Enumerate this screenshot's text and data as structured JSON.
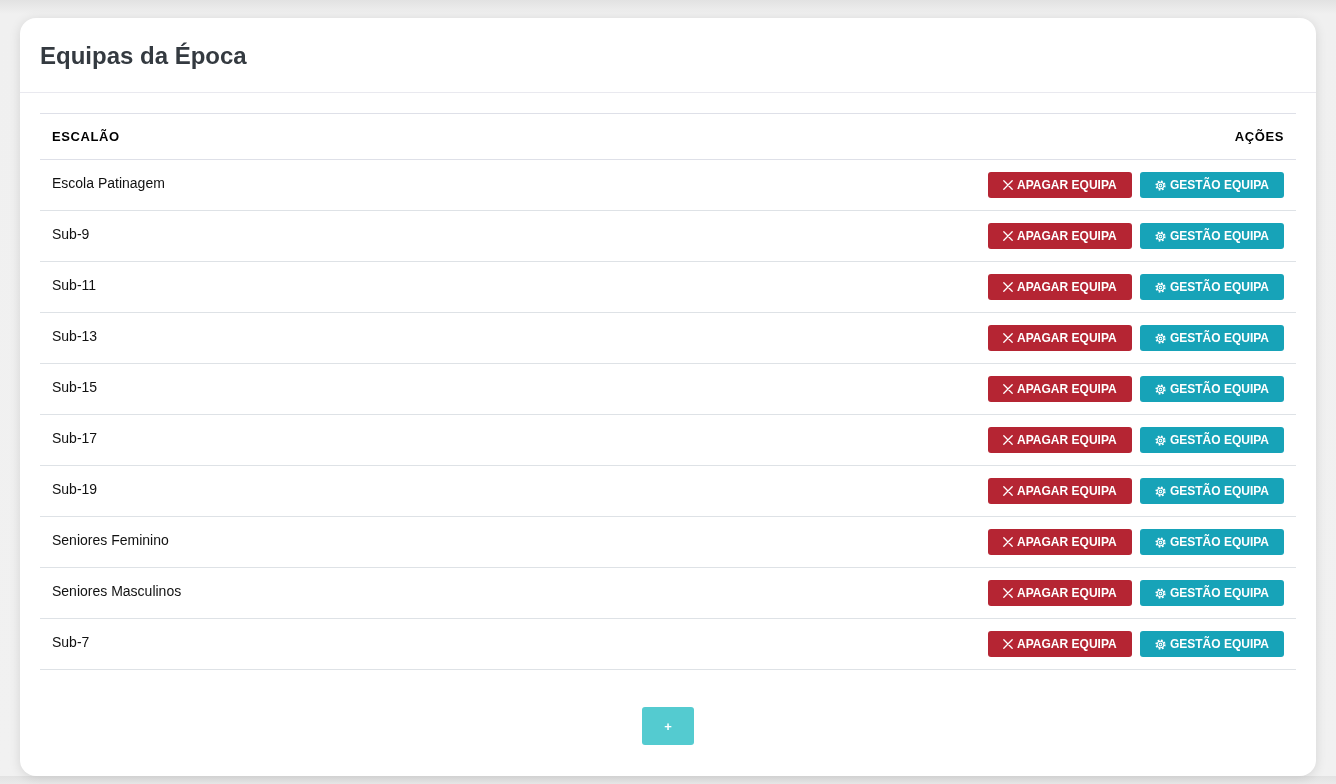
{
  "card": {
    "title": "Equipas da Época"
  },
  "table": {
    "columns": [
      "ESCALÃO",
      "AÇÕES"
    ],
    "rows": [
      {
        "escalao": "Escola Patinagem",
        "actions": [
          {
            "kind": "delete",
            "label": "APAGAR EQUIPA"
          },
          {
            "kind": "manage",
            "label": "GESTÃO EQUIPA"
          }
        ]
      },
      {
        "escalao": "Sub-9",
        "actions": [
          {
            "kind": "delete",
            "label": "APAGAR EQUIPA"
          },
          {
            "kind": "manage",
            "label": "GESTÃO EQUIPA"
          }
        ]
      },
      {
        "escalao": "Sub-11",
        "actions": [
          {
            "kind": "delete",
            "label": "APAGAR EQUIPA"
          },
          {
            "kind": "manage",
            "label": "GESTÃO EQUIPA"
          }
        ]
      },
      {
        "escalao": "Sub-13",
        "actions": [
          {
            "kind": "delete",
            "label": "APAGAR EQUIPA"
          },
          {
            "kind": "manage",
            "label": "GESTÃO EQUIPA"
          }
        ]
      },
      {
        "escalao": "Sub-15",
        "actions": [
          {
            "kind": "delete",
            "label": "APAGAR EQUIPA"
          },
          {
            "kind": "manage",
            "label": "GESTÃO EQUIPA"
          }
        ]
      },
      {
        "escalao": "Sub-17",
        "actions": [
          {
            "kind": "delete",
            "label": "APAGAR EQUIPA"
          },
          {
            "kind": "manage",
            "label": "GESTÃO EQUIPA"
          }
        ]
      },
      {
        "escalao": "Sub-19",
        "actions": [
          {
            "kind": "delete",
            "label": "APAGAR EQUIPA"
          },
          {
            "kind": "manage",
            "label": "GESTÃO EQUIPA"
          }
        ]
      },
      {
        "escalao": "Seniores Feminino",
        "actions": [
          {
            "kind": "delete",
            "label": "APAGAR EQUIPA"
          },
          {
            "kind": "manage",
            "label": "GESTÃO EQUIPA"
          }
        ]
      },
      {
        "escalao": "Seniores Masculinos",
        "actions": [
          {
            "kind": "delete",
            "label": "APAGAR EQUIPA"
          },
          {
            "kind": "manage",
            "label": "GESTÃO EQUIPA"
          }
        ]
      },
      {
        "escalao": "Sub-7",
        "actions": [
          {
            "kind": "delete",
            "label": "APAGAR EQUIPA"
          },
          {
            "kind": "manage",
            "label": "GESTÃO EQUIPA"
          }
        ]
      }
    ]
  },
  "add_button": {
    "label": "+"
  }
}
